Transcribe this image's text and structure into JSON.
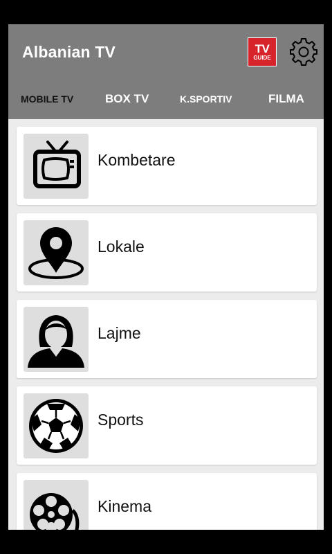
{
  "app": {
    "title": "Albanian TV"
  },
  "header": {
    "tv_guide": {
      "line1": "TV",
      "line2": "GUIDE",
      "color": "#d6242a"
    },
    "settings_icon": "gear-icon"
  },
  "tabs": [
    {
      "label": "MOBILE TV",
      "active": true
    },
    {
      "label": "BOX TV",
      "active": false
    },
    {
      "label": "K.SPORTIV",
      "active": false
    },
    {
      "label": "FILMA",
      "active": false
    }
  ],
  "categories": [
    {
      "label": "Kombetare",
      "icon": "tv-icon"
    },
    {
      "label": "Lokale",
      "icon": "location-pin-icon"
    },
    {
      "label": "Lajme",
      "icon": "news-anchor-icon"
    },
    {
      "label": "Sports",
      "icon": "soccer-ball-icon"
    },
    {
      "label": "Kinema",
      "icon": "film-reel-icon"
    }
  ],
  "colors": {
    "appbar": "#7d7d7d",
    "background": "#ececec",
    "active_tab": "#111111"
  }
}
